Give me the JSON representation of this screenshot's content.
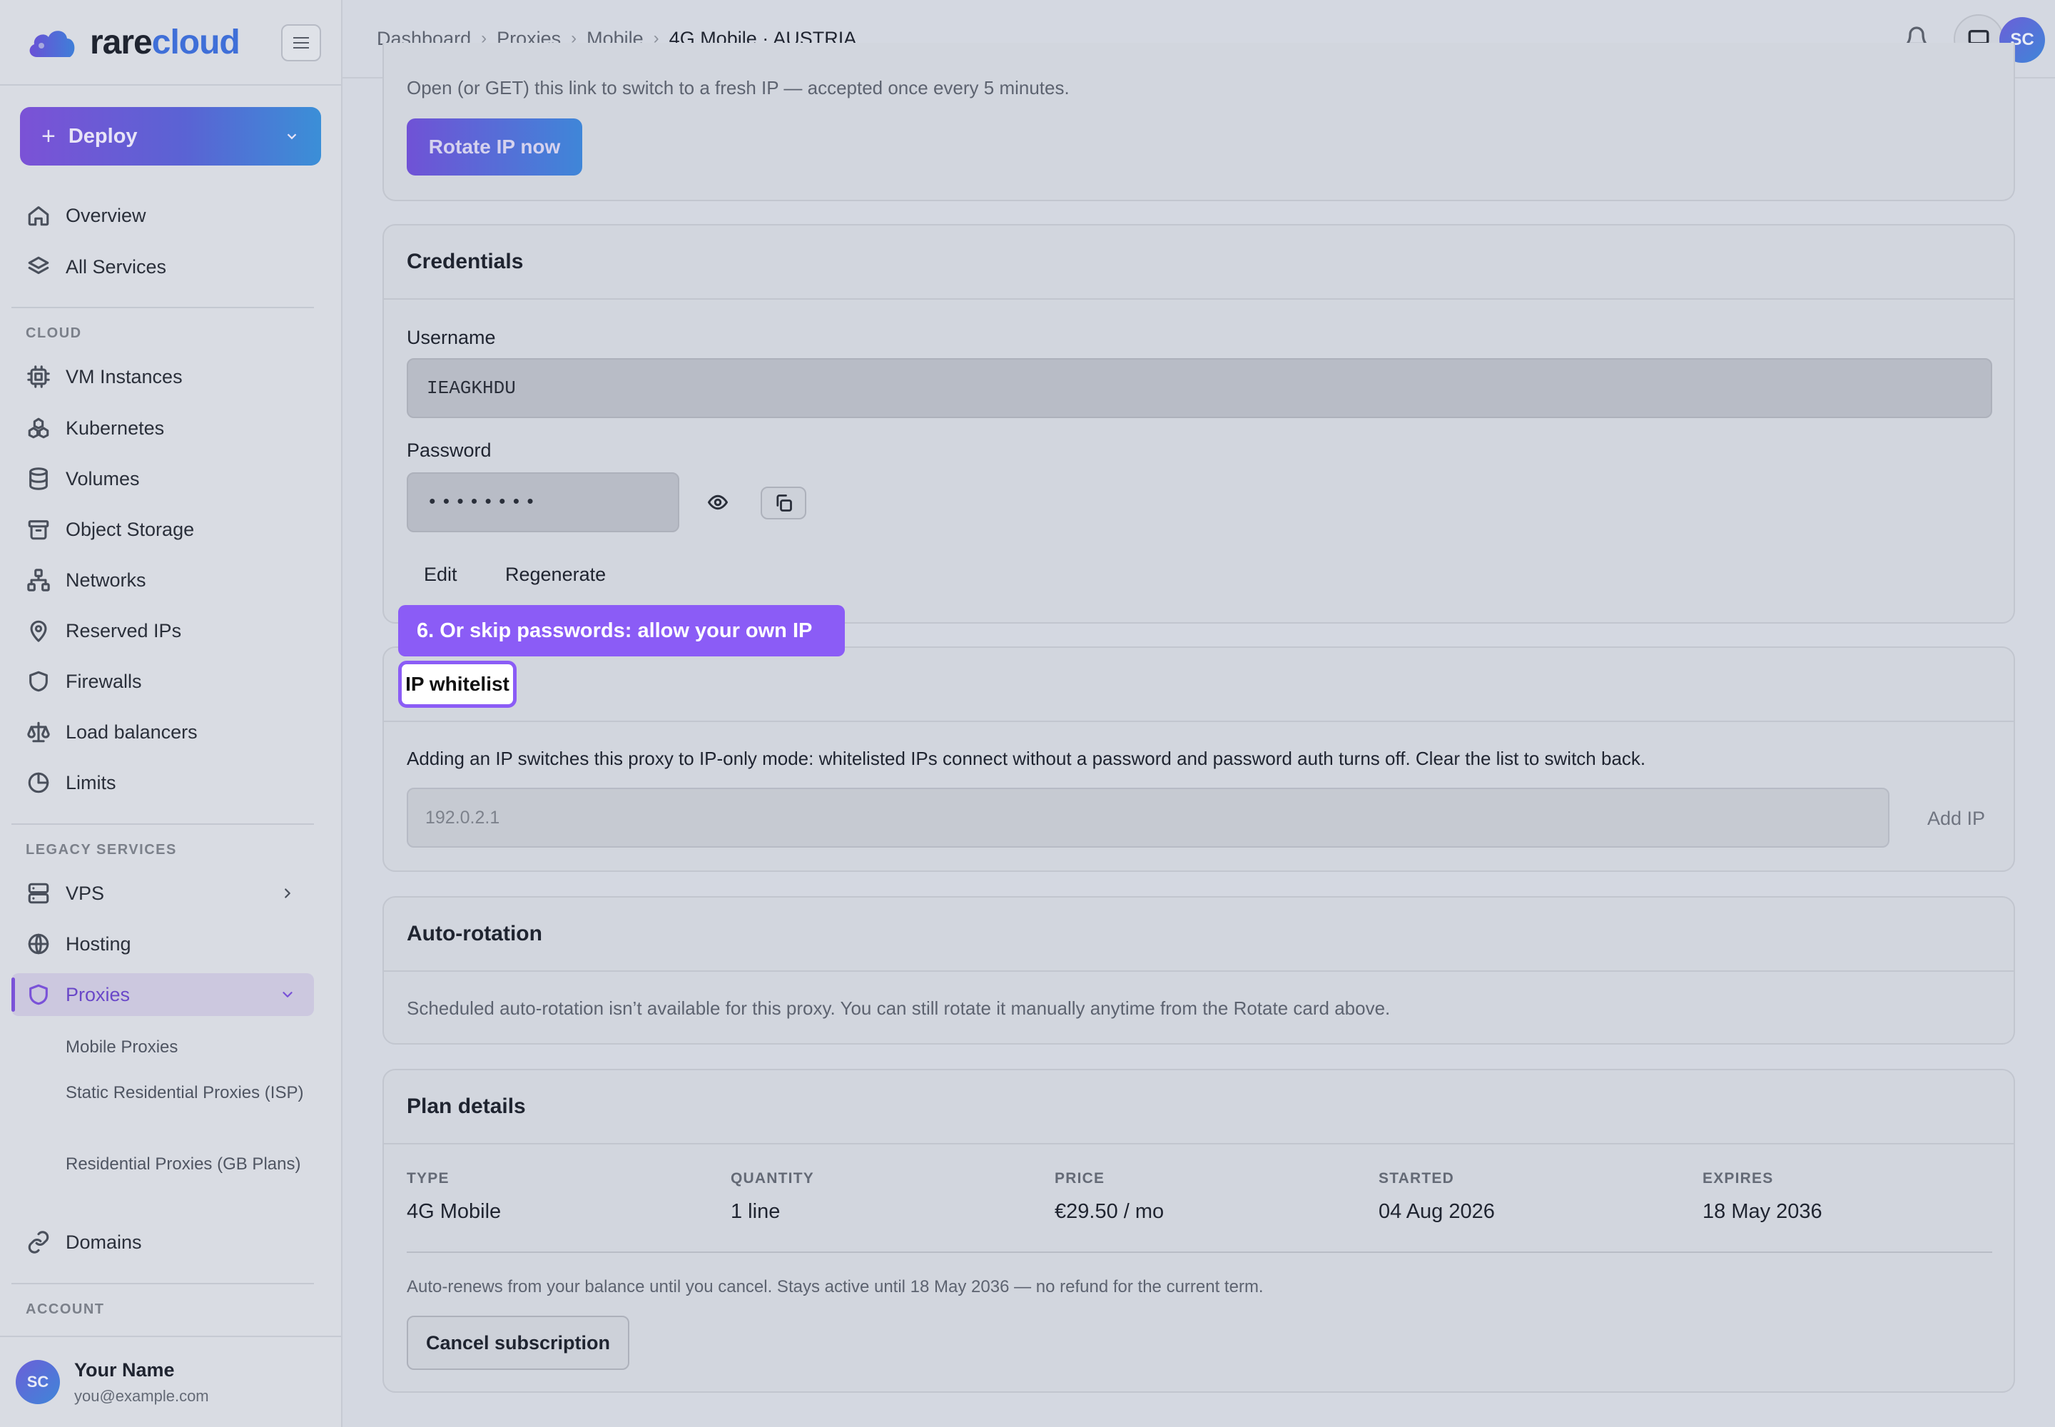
{
  "brand": {
    "name_part1": "rare",
    "name_part2": "cloud"
  },
  "sidebar": {
    "deploy_label": "Deploy",
    "top_items": [
      {
        "label": "Overview",
        "icon": "home-icon"
      },
      {
        "label": "All Services",
        "icon": "layers-icon"
      }
    ],
    "sections": {
      "cloud": "CLOUD",
      "legacy": "LEGACY SERVICES",
      "account": "ACCOUNT"
    },
    "cloud_items": [
      {
        "label": "VM Instances",
        "icon": "cpu-icon"
      },
      {
        "label": "Kubernetes",
        "icon": "kubernetes-icon"
      },
      {
        "label": "Volumes",
        "icon": "database-icon"
      },
      {
        "label": "Object Storage",
        "icon": "archive-icon"
      },
      {
        "label": "Networks",
        "icon": "network-icon"
      },
      {
        "label": "Reserved IPs",
        "icon": "map-pin-icon"
      },
      {
        "label": "Firewalls",
        "icon": "shield-icon"
      },
      {
        "label": "Load balancers",
        "icon": "scale-icon"
      },
      {
        "label": "Limits",
        "icon": "pie-chart-icon"
      }
    ],
    "legacy_items": [
      {
        "label": "VPS",
        "icon": "server-icon"
      },
      {
        "label": "Hosting",
        "icon": "globe-icon"
      },
      {
        "label": "Proxies",
        "icon": "shield-icon"
      }
    ],
    "proxy_sub_items": [
      "Mobile Proxies",
      "Static Residential Proxies (ISP)",
      "Residential Proxies (GB Plans)"
    ],
    "domains_label": "Domains",
    "user": {
      "initials": "SC",
      "name": "Your Name",
      "email": "you@example.com"
    }
  },
  "topbar": {
    "breadcrumbs": [
      "Dashboard",
      "Proxies",
      "Mobile",
      "4G Mobile · AUSTRIA"
    ],
    "avatar_initials": "SC"
  },
  "rotate": {
    "description": "Open (or GET) this link to switch to a fresh IP — accepted once every 5 minutes.",
    "button": "Rotate IP now"
  },
  "credentials": {
    "title": "Credentials",
    "username_label": "Username",
    "username_value": "IEAGKHDU",
    "password_label": "Password",
    "password_value": "••••••••",
    "edit": "Edit",
    "regenerate": "Regenerate"
  },
  "tooltip": {
    "text": "6. Or skip passwords: allow your own IP"
  },
  "whitelist": {
    "title": "IP whitelist",
    "description": "Adding an IP switches this proxy to IP-only mode: whitelisted IPs connect without a password and password auth turns off. Clear the list to switch back.",
    "placeholder": "192.0.2.1",
    "add_button": "Add IP"
  },
  "autorotation": {
    "title": "Auto-rotation",
    "description": "Scheduled auto-rotation isn’t available for this proxy. You can still rotate it manually anytime from the Rotate card above."
  },
  "plan": {
    "title": "Plan details",
    "columns": [
      {
        "key": "TYPE",
        "value": "4G Mobile"
      },
      {
        "key": "QUANTITY",
        "value": "1 line"
      },
      {
        "key": "PRICE",
        "value": "€29.50 / mo"
      },
      {
        "key": "STARTED",
        "value": "04 Aug 2026"
      },
      {
        "key": "EXPIRES",
        "value": "18 May 2036"
      }
    ],
    "renew_note": "Auto-renews from your balance until you cancel. Stays active until 18 May 2036 — no refund for the current term.",
    "cancel_button": "Cancel subscription"
  }
}
